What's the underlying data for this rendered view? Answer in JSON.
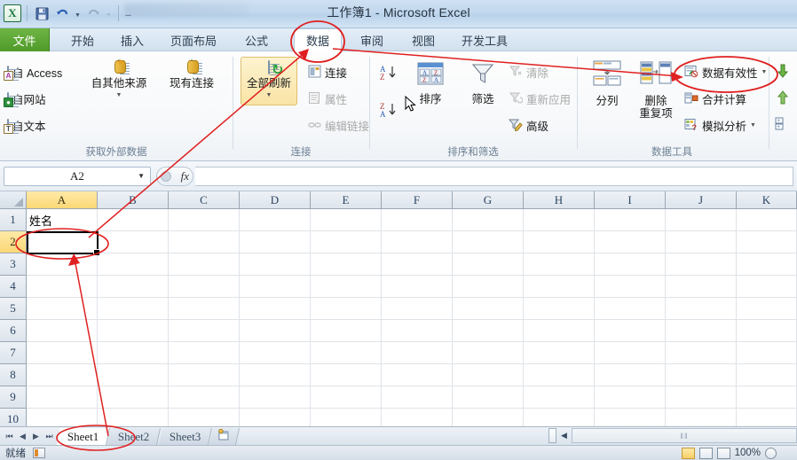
{
  "window": {
    "title": "工作簿1 - Microsoft Excel"
  },
  "quick_access": {
    "app_icon": "excel-logo-icon",
    "buttons": [
      {
        "name": "save-icon",
        "glyph": "▤",
        "disabled": false
      },
      {
        "name": "undo-icon",
        "glyph": "↶",
        "disabled": false
      },
      {
        "name": "redo-icon",
        "glyph": "↷",
        "disabled": true
      },
      {
        "name": "customize-qat-icon",
        "glyph": "▾",
        "disabled": false
      }
    ]
  },
  "tabs": [
    {
      "label": "文件",
      "active": false,
      "kind": "file"
    },
    {
      "label": "开始",
      "active": false
    },
    {
      "label": "插入",
      "active": false
    },
    {
      "label": "页面布局",
      "active": false
    },
    {
      "label": "公式",
      "active": false
    },
    {
      "label": "数据",
      "active": true
    },
    {
      "label": "审阅",
      "active": false
    },
    {
      "label": "视图",
      "active": false
    },
    {
      "label": "开发工具",
      "active": false
    }
  ],
  "ribbon": {
    "groups": [
      {
        "label": "获取外部数据",
        "small_items": [
          {
            "label": "自 Access",
            "icon": "access-doc-icon",
            "disabled": false
          },
          {
            "label": "自网站",
            "icon": "web-doc-icon",
            "disabled": false
          },
          {
            "label": "自文本",
            "icon": "text-doc-icon",
            "disabled": false
          }
        ],
        "big_items": [
          {
            "label": "自其他来源",
            "icon": "other-sources-icon",
            "dropdown": true
          },
          {
            "label": "现有连接",
            "icon": "existing-connections-icon",
            "dropdown": false
          }
        ]
      },
      {
        "label": "连接",
        "big_items": [
          {
            "label": "全部刷新",
            "icon": "refresh-all-icon",
            "dropdown": true,
            "highlighted": true
          }
        ],
        "small_items": [
          {
            "label": "连接",
            "icon": "connections-icon",
            "disabled": false
          },
          {
            "label": "属性",
            "icon": "properties-icon",
            "disabled": true
          },
          {
            "label": "编辑链接",
            "icon": "edit-links-icon",
            "disabled": true
          }
        ]
      },
      {
        "label": "排序和筛选",
        "sort_asc": "sort-ascending-icon",
        "sort_desc": "sort-descending-icon",
        "big_items": [
          {
            "label": "排序",
            "icon": "sort-dialog-icon"
          },
          {
            "label": "筛选",
            "icon": "filter-funnel-icon"
          }
        ],
        "small_items": [
          {
            "label": "清除",
            "icon": "clear-filter-icon",
            "disabled": true
          },
          {
            "label": "重新应用",
            "icon": "reapply-filter-icon",
            "disabled": true
          },
          {
            "label": "高级",
            "icon": "advanced-filter-icon",
            "disabled": false
          }
        ]
      },
      {
        "label": "数据工具",
        "big_items": [
          {
            "label": "分列",
            "icon": "text-to-columns-icon"
          },
          {
            "label": "删除\n重复项",
            "label_line1": "删除",
            "label_line2": "重复项",
            "icon": "remove-duplicates-icon"
          }
        ],
        "small_items": [
          {
            "label": "数据有效性",
            "icon": "data-validation-icon",
            "dropdown": true,
            "disabled": false
          },
          {
            "label": "合并计算",
            "icon": "consolidate-icon",
            "disabled": false
          },
          {
            "label": "模拟分析",
            "icon": "what-if-analysis-icon",
            "dropdown": true,
            "disabled": false
          }
        ]
      },
      {
        "label": "",
        "partial": true,
        "small_items": [
          {
            "label": "",
            "icon": "group-rows-icon"
          },
          {
            "label": "",
            "icon": "ungroup-rows-icon"
          },
          {
            "label": "",
            "icon": "subtotal-icon"
          }
        ]
      }
    ]
  },
  "formula_bar": {
    "name_box_value": "A2",
    "name_box_caret": "▾",
    "fx_label": "fx",
    "formula_value": "",
    "formula_placeholder": ""
  },
  "sheet": {
    "columns": [
      "A",
      "B",
      "C",
      "D",
      "E",
      "F",
      "G",
      "H",
      "I",
      "J",
      "K"
    ],
    "selected_column": "A",
    "rows": [
      "1",
      "2",
      "3",
      "4",
      "5",
      "6",
      "7",
      "8",
      "9",
      "10"
    ],
    "selected_row": "2",
    "cells": [
      {
        "ref": "A1",
        "col": 0,
        "row": 0,
        "value": "姓名"
      }
    ],
    "active_cell": "A2"
  },
  "sheet_tabs": {
    "nav": [
      "⏮",
      "◀",
      "▶",
      "⏭"
    ],
    "items": [
      {
        "label": "Sheet1",
        "active": true
      },
      {
        "label": "Sheet2",
        "active": false
      },
      {
        "label": "Sheet3",
        "active": false
      }
    ],
    "insert_sheet_icon": "insert-worksheet-icon"
  },
  "scroll": {
    "grip": "‖‖"
  },
  "status_bar": {
    "mode": "就绪",
    "record_macro_icon": "record-macro-icon",
    "views": [
      {
        "name": "normal-view-button",
        "active": true
      },
      {
        "name": "page-layout-view-button",
        "active": false
      },
      {
        "name": "page-break-preview-button",
        "active": false
      }
    ],
    "zoom": "100%"
  },
  "annotations": {
    "color": "#e02020",
    "marks": [
      {
        "name": "ellipse-data-tab",
        "shape": "ellipse"
      },
      {
        "name": "ellipse-data-validation",
        "shape": "ellipse"
      },
      {
        "name": "ellipse-cell-a2",
        "shape": "ellipse"
      },
      {
        "name": "ellipse-sheet1-tab",
        "shape": "ellipse"
      },
      {
        "name": "arrow-a2-to-data-tab",
        "shape": "arrow"
      },
      {
        "name": "arrow-data-tab-to-validation",
        "shape": "arrow"
      },
      {
        "name": "arrow-sheet1-to-a2",
        "shape": "arrow"
      }
    ]
  }
}
